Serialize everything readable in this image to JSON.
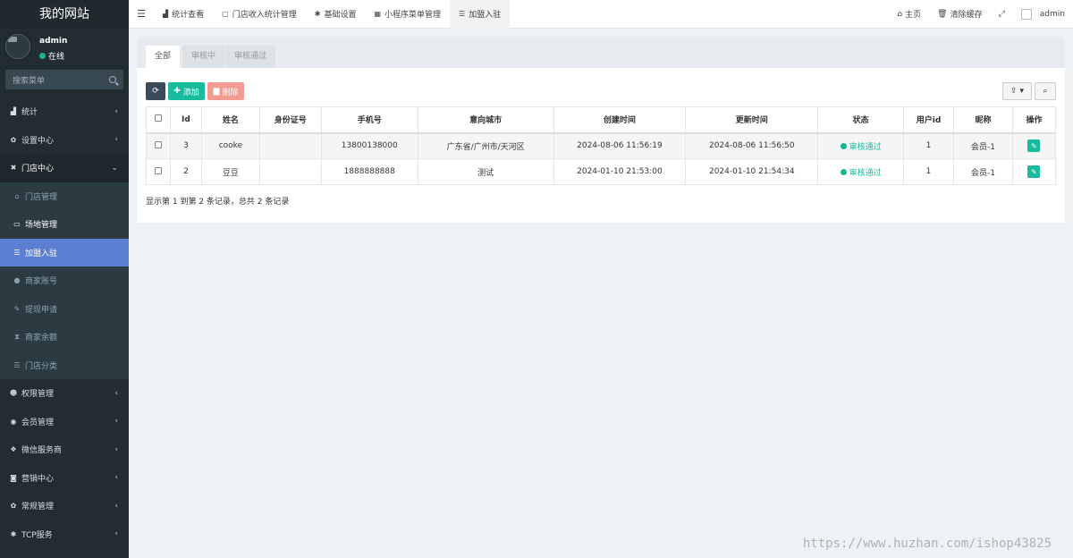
{
  "sidebar": {
    "logo": "我的网站",
    "user": {
      "name": "admin",
      "status": "在线"
    },
    "search_placeholder": "搜索菜单",
    "items": [
      {
        "icon": "chart-icon",
        "label": "统计"
      },
      {
        "icon": "cogs-icon",
        "label": "设置中心"
      },
      {
        "icon": "store-icon",
        "label": "门店中心"
      },
      {
        "icon": "users-icon",
        "label": "权限管理"
      },
      {
        "icon": "user-circle-icon",
        "label": "会员管理"
      },
      {
        "icon": "wechat-icon",
        "label": "微信服务商"
      },
      {
        "icon": "car-icon",
        "label": "营销中心"
      },
      {
        "icon": "cogs-icon",
        "label": "常规管理"
      },
      {
        "icon": "asterisk-icon",
        "label": "TCP服务"
      }
    ],
    "subitems": [
      {
        "icon": "home-icon",
        "label": "门店管理"
      },
      {
        "icon": "laptop-icon",
        "label": "场地管理"
      },
      {
        "icon": "list-icon",
        "label": "加盟入驻"
      },
      {
        "icon": "user-icon",
        "label": "商家账号"
      },
      {
        "icon": "edit-icon",
        "label": "提现申请"
      },
      {
        "icon": "hourglass-icon",
        "label": "商家余额"
      },
      {
        "icon": "list-icon",
        "label": "门店分类"
      }
    ]
  },
  "topbar": {
    "tabs": [
      {
        "icon": "chart-icon",
        "label": "统计查看"
      },
      {
        "icon": "doc-icon",
        "label": "门店收入统计管理"
      },
      {
        "icon": "asterisk-icon",
        "label": "基础设置"
      },
      {
        "icon": "grid-icon",
        "label": "小程序菜单管理"
      },
      {
        "icon": "list-icon",
        "label": "加盟入驻"
      }
    ],
    "home": "主页",
    "clear_cache": "清除缓存",
    "user": "admin"
  },
  "content": {
    "filter_tabs": [
      "全部",
      "审核中",
      "审核通过"
    ],
    "buttons": {
      "add": "添加",
      "delete": "删除"
    },
    "columns": [
      "Id",
      "姓名",
      "身份证号",
      "手机号",
      "意向城市",
      "创建时间",
      "更新时间",
      "状态",
      "用户id",
      "昵称",
      "操作"
    ],
    "rows": [
      {
        "id": "3",
        "name": "cooke",
        "idcard": "",
        "phone": "13800138000",
        "city": "广东省/广州市/天河区",
        "created": "2024-08-06 11:56:19",
        "updated": "2024-08-06 11:56:50",
        "status": "审核通过",
        "uid": "1",
        "nickname": "会员-1"
      },
      {
        "id": "2",
        "name": "豆豆",
        "idcard": "",
        "phone": "1888888888",
        "city": "测试",
        "created": "2024-01-10 21:53:00",
        "updated": "2024-01-10 21:54:34",
        "status": "审核通过",
        "uid": "1",
        "nickname": "会员-1"
      }
    ],
    "page_info": "显示第 1 到第 2 条记录，总共 2 条记录"
  },
  "watermark": "https://www.huzhan.com/ishop43825",
  "colors": {
    "sidebar": "#222d32",
    "active": "#5d7fd2",
    "success": "#18bc9c",
    "danger": "#f29b90"
  }
}
